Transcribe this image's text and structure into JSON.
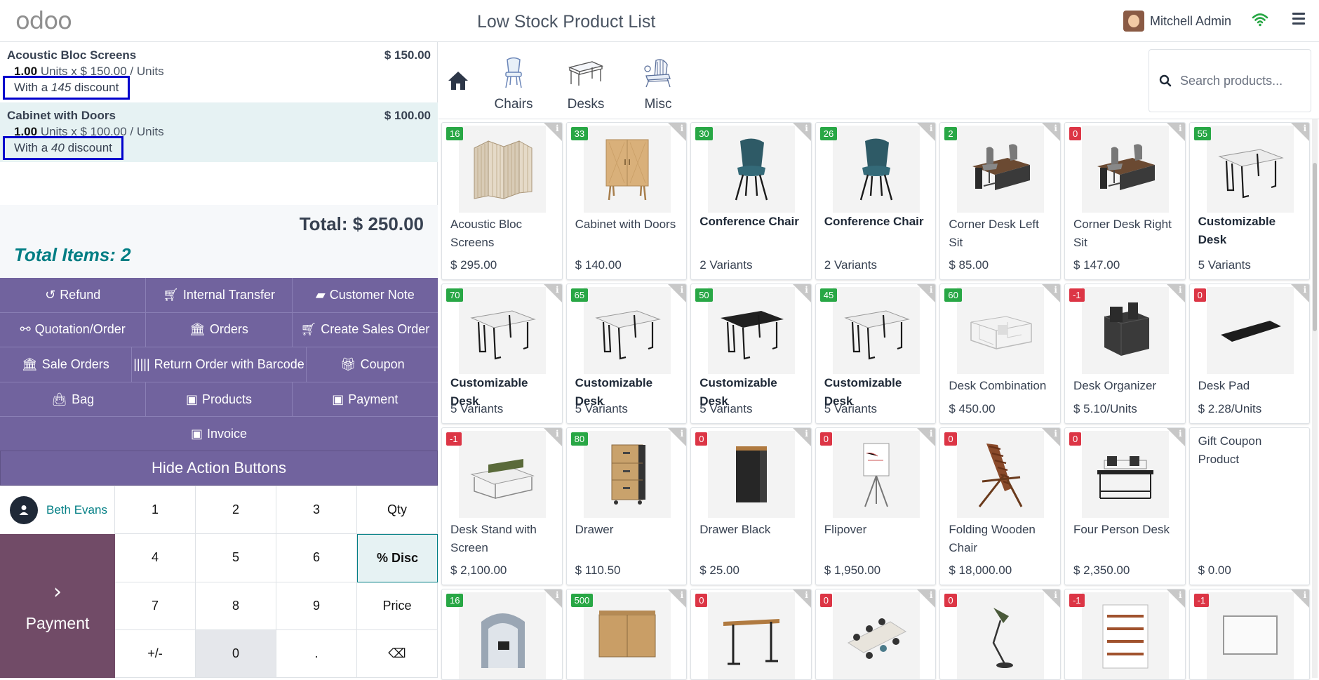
{
  "header": {
    "logo": "odoo",
    "title": "Low Stock Product List",
    "user_name": "Mitchell Admin"
  },
  "order": {
    "lines": [
      {
        "name": "Acoustic Bloc Screens",
        "price": "$ 150.00",
        "qty": "1.00",
        "unit_text": "Units x $ 150.00 / Units",
        "disc_pre": "With a",
        "disc_val": "145",
        "disc_post": "discount"
      },
      {
        "name": "Cabinet with Doors",
        "price": "$ 100.00",
        "qty": "1.00",
        "unit_text": "Units x $ 100.00 / Units",
        "disc_pre": "With a",
        "disc_val": "40",
        "disc_post": "discount"
      }
    ],
    "total": "Total: $ 250.00",
    "total_items": "Total Items: 2"
  },
  "actions": {
    "refund": "Refund",
    "internal_transfer": "Internal Transfer",
    "customer_note": "Customer Note",
    "quotation": "Quotation/Order",
    "orders": "Orders",
    "create_sales_order": "Create Sales Order",
    "sale_orders": "Sale Orders",
    "return_barcode": "Return Order with Barcode",
    "coupon": "Coupon",
    "bag": "Bag",
    "products": "Products",
    "payment": "Payment",
    "invoice": "Invoice",
    "hide": "Hide Action Buttons"
  },
  "customer": {
    "name": "Beth Evans"
  },
  "payment_label": "Payment",
  "numpad": [
    "1",
    "2",
    "3",
    "Qty",
    "4",
    "5",
    "6",
    "% Disc",
    "7",
    "8",
    "9",
    "Price",
    "+/-",
    "0",
    ".",
    "⌫"
  ],
  "categories": [
    {
      "label": "Chairs",
      "icon": "chair-icon"
    },
    {
      "label": "Desks",
      "icon": "desk-icon"
    },
    {
      "label": "Misc",
      "icon": "misc-icon"
    }
  ],
  "search": {
    "placeholder": "Search products..."
  },
  "products": [
    {
      "name": "Acoustic Bloc Screens",
      "price": "$ 295.00",
      "stock": "16",
      "status": "g",
      "icon": "screen"
    },
    {
      "name": "Cabinet with Doors",
      "price": "$ 140.00",
      "stock": "33",
      "status": "g",
      "icon": "cabinet"
    },
    {
      "name": "Conference Chair",
      "price": "2 Variants",
      "stock": "30",
      "status": "g",
      "icon": "chair",
      "bold": true
    },
    {
      "name": "Conference Chair",
      "price": "2 Variants",
      "stock": "26",
      "status": "g",
      "icon": "chair",
      "bold": true
    },
    {
      "name": "Corner Desk Left Sit",
      "price": "$ 85.00",
      "stock": "2",
      "status": "g",
      "icon": "cornerdesk"
    },
    {
      "name": "Corner Desk Right Sit",
      "price": "$ 147.00",
      "stock": "0",
      "status": "r",
      "icon": "cornerdesk"
    },
    {
      "name": "Customizable Desk",
      "price": "5 Variants",
      "stock": "55",
      "status": "g",
      "icon": "desk",
      "bold": true
    },
    {
      "name": "Customizable Desk",
      "price": "5 Variants",
      "stock": "70",
      "status": "g",
      "icon": "desk",
      "bold": true
    },
    {
      "name": "Customizable Desk",
      "price": "5 Variants",
      "stock": "65",
      "status": "g",
      "icon": "desk",
      "bold": true
    },
    {
      "name": "Customizable Desk",
      "price": "5 Variants",
      "stock": "50",
      "status": "g",
      "icon": "deskblack",
      "bold": true
    },
    {
      "name": "Customizable Desk",
      "price": "5 Variants",
      "stock": "45",
      "status": "g",
      "icon": "desk",
      "bold": true
    },
    {
      "name": "Desk Combination",
      "price": "$ 450.00",
      "stock": "60",
      "status": "g",
      "icon": "deskcombo"
    },
    {
      "name": "Desk Organizer",
      "price": "$ 5.10/Units",
      "stock": "-1",
      "status": "r",
      "icon": "organizer"
    },
    {
      "name": "Desk Pad",
      "price": "$ 2.28/Units",
      "stock": "0",
      "status": "r",
      "icon": "pad"
    },
    {
      "name": "Desk Stand with Screen",
      "price": "$ 2,100.00",
      "stock": "-1",
      "status": "r",
      "icon": "deskstand"
    },
    {
      "name": "Drawer",
      "price": "$ 110.50",
      "stock": "80",
      "status": "g",
      "icon": "drawer"
    },
    {
      "name": "Drawer Black",
      "price": "$ 25.00",
      "stock": "0",
      "status": "r",
      "icon": "drawerblack"
    },
    {
      "name": "Flipover",
      "price": "$ 1,950.00",
      "stock": "0",
      "status": "r",
      "icon": "flipover"
    },
    {
      "name": "Folding Wooden Chair",
      "price": "$ 18,000.00",
      "stock": "0",
      "status": "r",
      "icon": "folding"
    },
    {
      "name": "Four Person Desk",
      "price": "$ 2,350.00",
      "stock": "0",
      "status": "r",
      "icon": "fourdesk"
    },
    {
      "name": "Gift Coupon Product",
      "price": "$ 0.00",
      "stock": "",
      "status": "",
      "icon": ""
    },
    {
      "name": "",
      "price": "",
      "stock": "16",
      "status": "g",
      "icon": "pod"
    },
    {
      "name": "",
      "price": "",
      "stock": "500",
      "status": "g",
      "icon": "sideboard"
    },
    {
      "name": "",
      "price": "",
      "stock": "0",
      "status": "r",
      "icon": "standdesk"
    },
    {
      "name": "",
      "price": "",
      "stock": "0",
      "status": "r",
      "icon": "meeting"
    },
    {
      "name": "",
      "price": "",
      "stock": "0",
      "status": "r",
      "icon": "lamp"
    },
    {
      "name": "",
      "price": "",
      "stock": "-1",
      "status": "r",
      "icon": "shelf"
    },
    {
      "name": "",
      "price": "",
      "stock": "-1",
      "status": "r",
      "icon": "whiteboard"
    }
  ]
}
